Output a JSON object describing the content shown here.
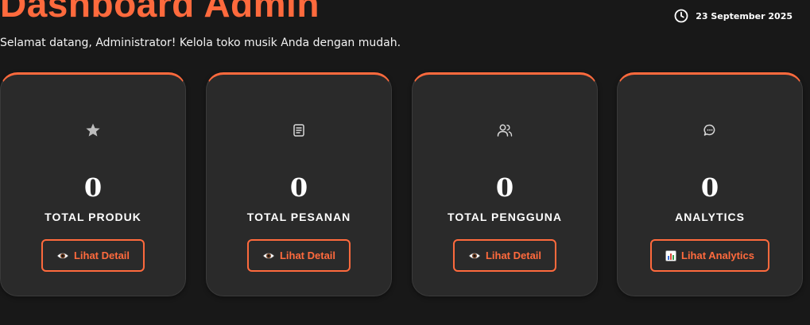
{
  "header": {
    "title": "Dashboard Admin",
    "subtitle": "Selamat datang, Administrator! Kelola toko musik Anda dengan mudah.",
    "date": "23 September 2025",
    "date_icon": "clock-icon"
  },
  "colors": {
    "accent": "#ff6a3d",
    "background": "#181818",
    "card": "#2a2a2a"
  },
  "cards": [
    {
      "icon": "star-icon",
      "value": "0",
      "label": "TOTAL PRODUK",
      "button_label": "Lihat Detail",
      "button_icon": "eye-icon"
    },
    {
      "icon": "document-list-icon",
      "value": "0",
      "label": "TOTAL PESANAN",
      "button_label": "Lihat Detail",
      "button_icon": "eye-icon"
    },
    {
      "icon": "users-icon",
      "value": "0",
      "label": "TOTAL PENGGUNA",
      "button_label": "Lihat Detail",
      "button_icon": "eye-icon"
    },
    {
      "icon": "chat-bubble-icon",
      "value": "0",
      "label": "ANALYTICS",
      "button_label": "Lihat Analytics",
      "button_icon": "bar-chart-icon"
    }
  ]
}
